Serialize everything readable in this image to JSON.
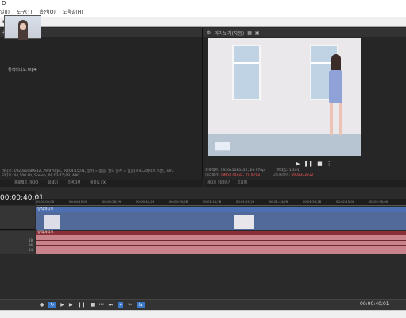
{
  "window": {
    "title_fragment": "D"
  },
  "menu": [
    "일(I)",
    "도구(T)",
    "옵션(O)",
    "도움말(H)"
  ],
  "toolbar_icons": [
    "folder-icon",
    "undo-icon",
    "redo-icon",
    "cut-icon",
    "copy-icon"
  ],
  "explorer": {
    "clip_label": "뮤직비디오.mp4",
    "info_line1": "비디오: 1920x1080x32, 29.970fps, 00:03:15;01, 알파 = 없음, 필드 순서 = 없음(프로그레시브 스캔), AVC",
    "info_line2": "오디오: 44,100 Hz, Stereo, 00:03:15;03, AAC",
    "tabs": [
      "프로젝트 미디어",
      "탐색기",
      "트랜지션",
      "비디오 FX"
    ]
  },
  "preview": {
    "toolbar_label": "미리보기(자동)",
    "frame_label": "프레임:",
    "frame_value": "1,201",
    "project_label": "프로젝트:",
    "project_value": "1920x1080x32, 29.970p",
    "preview_label": "미리보기:",
    "preview_value": "480x270x32, 29.970p",
    "display_label": "디스플레이:",
    "display_value": "590x332x32",
    "tabs": [
      "비디오 미리보기",
      "트리머"
    ]
  },
  "timeline": {
    "timecode": "00:00:40;01",
    "ruler": [
      "00:00:00;00",
      "00:00:15;00",
      "00:00:29;29",
      "00:00:44;29",
      "00:00:59;28",
      "00:01:14;28",
      "00:01:29;29",
      "00:01:44;29",
      "00:01:59;28",
      "00:02:15;00",
      "00:02:30;00"
    ],
    "video_clip_label": "뮤직비디오",
    "audio_clip_label": "뮤직비디오",
    "audio_levels": [
      "18",
      "36",
      "54"
    ],
    "bottom_timecode": "00:00:40;01"
  },
  "colors": {
    "video_track": "#526a9a",
    "audio_track": "#c8848a",
    "clip_header_video": "#4d6fb4",
    "clip_header_audio": "#8a2f38"
  }
}
